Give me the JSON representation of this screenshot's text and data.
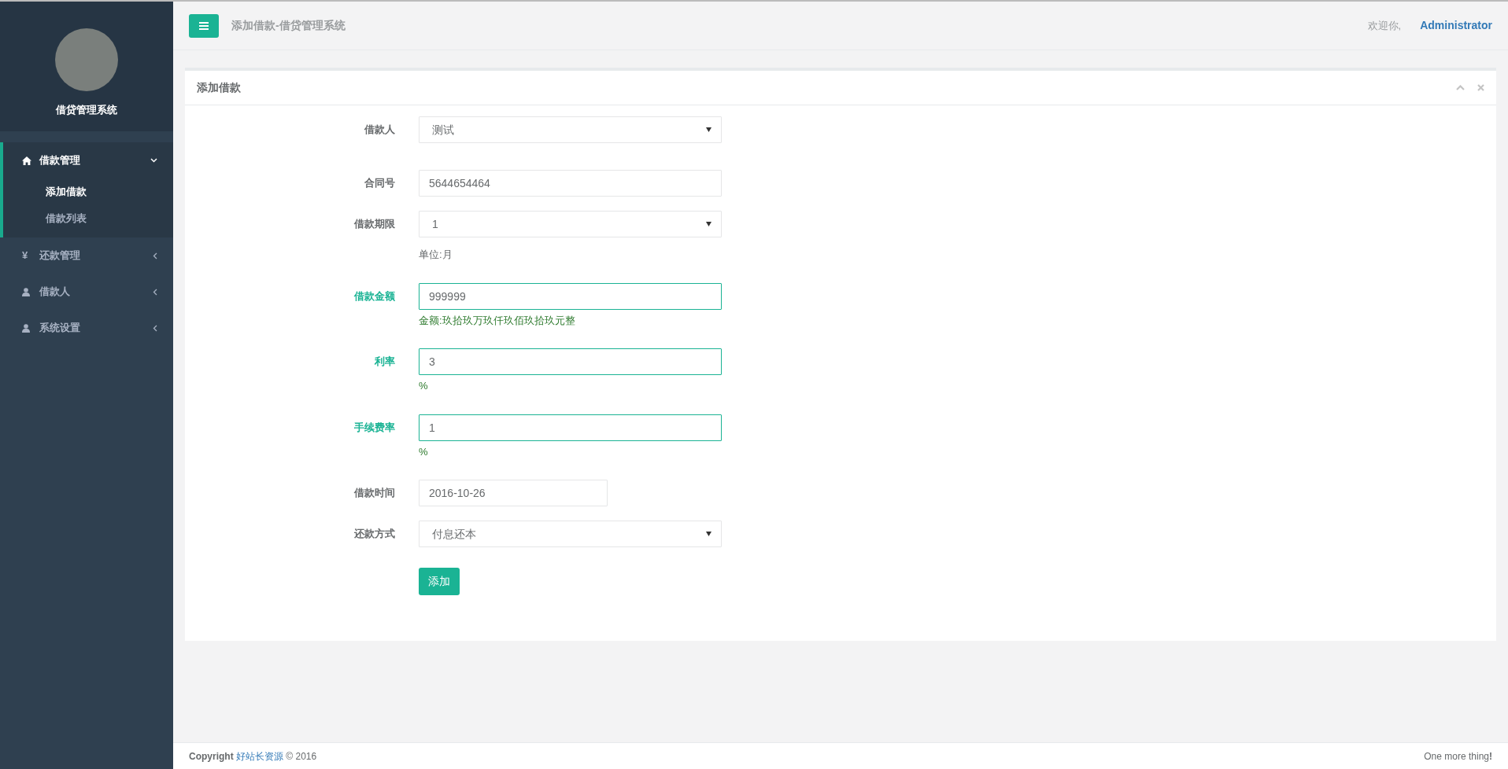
{
  "sidebar": {
    "app_name": "借贷管理系统",
    "menu": [
      {
        "label": "借款管理",
        "expanded": true,
        "selected": true,
        "children": [
          {
            "label": "添加借款",
            "selected": true
          },
          {
            "label": "借款列表",
            "selected": false
          }
        ]
      },
      {
        "label": "还款管理",
        "icon_text": "¥",
        "expanded": false,
        "selected": false
      },
      {
        "label": "借款人",
        "expanded": false,
        "selected": false
      },
      {
        "label": "系统设置",
        "expanded": false,
        "selected": false
      }
    ]
  },
  "header": {
    "page_title": "添加借款-借贷管理系统",
    "welcome": "欢迎你,",
    "user": "Administrator"
  },
  "panel": {
    "title": "添加借款",
    "fields": [
      {
        "label": "借款人",
        "kind": "select",
        "value": "测试",
        "valid": false
      },
      {
        "label": "合同号",
        "kind": "text",
        "value": "5644654464",
        "valid": false
      },
      {
        "label": "借款期限",
        "kind": "select",
        "value": "1",
        "valid": false,
        "help": "单位:月"
      },
      {
        "label": "借款金额",
        "kind": "text",
        "value": "999999",
        "valid": true,
        "help": "金额:玖拾玖万玖仟玖佰玖拾玖元整"
      },
      {
        "label": "利率",
        "kind": "text",
        "value": "3",
        "valid": true,
        "help": "%"
      },
      {
        "label": "手续费率",
        "kind": "text",
        "value": "1",
        "valid": true,
        "help": "%"
      },
      {
        "label": "借款时间",
        "kind": "date",
        "value": "2016-10-26",
        "valid": false
      },
      {
        "label": "还款方式",
        "kind": "select",
        "value": "付息还本",
        "valid": false
      }
    ],
    "submit": "添加"
  },
  "footer": {
    "copyright": "Copyright",
    "link": "好站长资源",
    "year": "© 2016",
    "right": "One more thing**!**"
  }
}
